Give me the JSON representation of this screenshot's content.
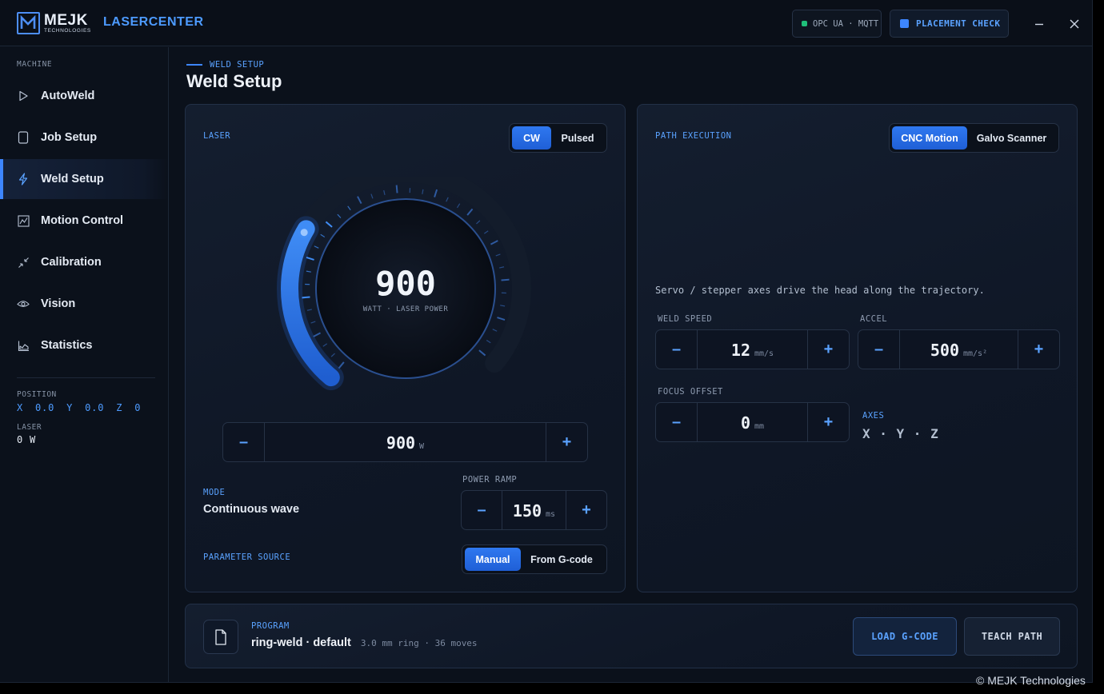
{
  "brand": {
    "name": "MEJK",
    "sub": "TECHNOLOGIES",
    "app_title": "LASERCENTER"
  },
  "header": {
    "status_text": "OPC UA · MQTT",
    "placement_check": "PLACEMENT CHECK",
    "status_color": "#1fbf7a",
    "accent": "#3d86ff"
  },
  "sidebar": {
    "section": "MACHINE",
    "items": [
      {
        "label": "AutoWeld",
        "icon": "play-icon"
      },
      {
        "label": "Job Setup",
        "icon": "document-icon"
      },
      {
        "label": "Weld Setup",
        "icon": "lightning-icon",
        "active": true
      },
      {
        "label": "Motion Control",
        "icon": "chart-line-icon"
      },
      {
        "label": "Calibration",
        "icon": "compress-arrows-icon"
      },
      {
        "label": "Vision",
        "icon": "eye-icon"
      },
      {
        "label": "Statistics",
        "icon": "area-chart-icon"
      }
    ],
    "position_label": "POSITION",
    "position": {
      "x_label": "X",
      "x": "0.0",
      "y_label": "Y",
      "y": "0.0",
      "z_label": "Z",
      "z": "0"
    },
    "laser_label": "LASER",
    "laser_value": "0 W"
  },
  "page": {
    "breadcrumb": "WELD SETUP",
    "title": "Weld Setup"
  },
  "laser": {
    "label": "LASER",
    "modes": [
      "CW",
      "Pulsed"
    ],
    "selected_mode": "CW",
    "power": "900",
    "power_caption": "WATT · LASER POWER",
    "power_fraction": 0.3,
    "power_value": "900",
    "power_unit": "W",
    "mode_label": "MODE",
    "mode_value": "Continuous wave",
    "ramp_label": "POWER RAMP",
    "ramp_value": "150",
    "ramp_unit": "ms",
    "source_label": "PARAMETER SOURCE",
    "sources": [
      "Manual",
      "From G-code"
    ],
    "selected_source": "Manual"
  },
  "path": {
    "label": "PATH EXECUTION",
    "modes": [
      "CNC Motion",
      "Galvo Scanner"
    ],
    "selected_mode": "CNC Motion",
    "description": "Servo / stepper axes drive the head along the trajectory.",
    "speed_label": "WELD SPEED",
    "speed_value": "12",
    "speed_unit": "mm/s",
    "accel_label": "ACCEL",
    "accel_value": "500",
    "accel_unit": "mm/s²",
    "focus_label": "FOCUS OFFSET",
    "focus_value": "0",
    "focus_unit": "mm",
    "axes_label": "AXES",
    "axes_value": "X · Y · Z"
  },
  "program": {
    "label": "PROGRAM",
    "name": "ring-weld · default",
    "meta": "3.0 mm ring · 36 moves",
    "load_button": "LOAD G-CODE",
    "teach_button": "TEACH PATH"
  },
  "footer": {
    "copyright": "© MEJK Technologies"
  }
}
